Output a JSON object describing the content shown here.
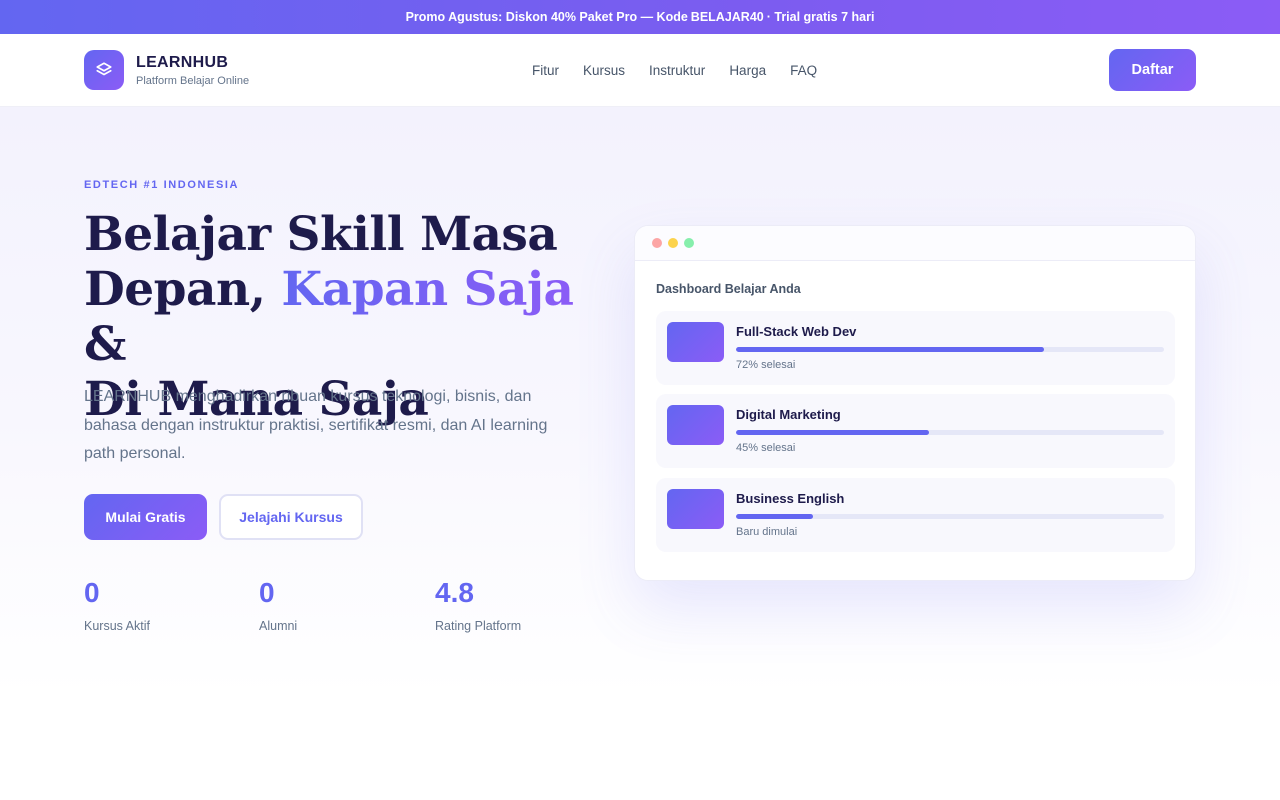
{
  "promo": {
    "prefix": "Promo Agustus: Diskon 40% Paket Pro — Kode",
    "code": "BELAJAR40",
    "suffix": "· Trial gratis 7 hari"
  },
  "brand": {
    "name": "LEARNHUB",
    "tagline": "Platform Belajar Online",
    "logo_icon": "layers-icon"
  },
  "nav": {
    "items": [
      "Fitur",
      "Kursus",
      "Instruktur",
      "Harga",
      "FAQ"
    ],
    "signup_label": "Daftar"
  },
  "hero": {
    "eyebrow": "EDTECH #1 INDONESIA",
    "headline_line1": "Belajar Skill Masa",
    "headline_line2_start": "Depan,",
    "headline_accent": "Kapan Saja",
    "headline_line2_end": "&",
    "headline_line3": "Di Mana Saja",
    "description": "LEARNHUB menghadirkan ribuan kursus teknologi, bisnis, dan bahasa dengan instruktur praktisi, sertifikat resmi, dan AI learning path personal.",
    "cta_primary": "Mulai Gratis",
    "cta_secondary": "Jelajahi Kursus",
    "stats": [
      {
        "value": "0",
        "label": "Kursus Aktif"
      },
      {
        "value": "0",
        "label": "Alumni"
      },
      {
        "value": "4.8",
        "label": "Rating Platform"
      }
    ]
  },
  "dashboard": {
    "title": "Dashboard Belajar Anda",
    "courses": [
      {
        "name": "Full-Stack Web Dev",
        "progress": 0.72,
        "status": "72% selesai"
      },
      {
        "name": "Digital Marketing",
        "progress": 0.45,
        "status": "45% selesai"
      },
      {
        "name": "Business English",
        "progress": 0.18,
        "status": "Baru dimulai"
      }
    ]
  },
  "colors": {
    "accent": "#6366f1",
    "accent_purple": "#8b5cf6",
    "heading": "#1e1b4b",
    "muted": "#64748b"
  }
}
